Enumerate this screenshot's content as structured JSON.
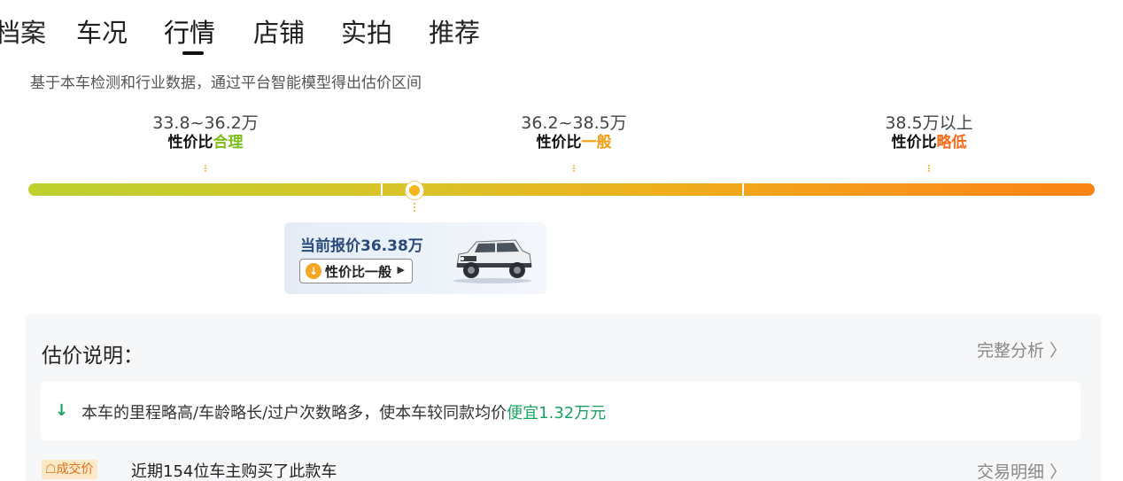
{
  "tabs": [
    {
      "label": "档案",
      "active": false
    },
    {
      "label": "车况",
      "active": false
    },
    {
      "label": "行情",
      "active": true
    },
    {
      "label": "店铺",
      "active": false
    },
    {
      "label": "实拍",
      "active": false
    },
    {
      "label": "推荐",
      "active": false
    }
  ],
  "subtitle": "基于本车检测和行业数据，通过平台智能模型得出估价区间",
  "ranges": [
    {
      "price": "33.8~36.2万",
      "verdict_prefix": "性价比",
      "verdict_tag": "合理",
      "color": "#7cbd17"
    },
    {
      "price": "36.2~38.5万",
      "verdict_prefix": "性价比",
      "verdict_tag": "一般",
      "color": "#f39c12"
    },
    {
      "price": "38.5万以上",
      "verdict_prefix": "性价比",
      "verdict_tag": "略低",
      "color": "#fa6b18"
    }
  ],
  "current": {
    "price_label": "当前报价36.38万",
    "verdict": "性价比一般",
    "price_wan": 36.38,
    "car_icon": "suv-car-image"
  },
  "explain": {
    "title": "估价说明：",
    "full_analysis": "完整分析",
    "reason_text": "本车的里程略高/车龄略长/过户次数略多，使本车较同款均价",
    "reason_highlight": "便宜1.32万元",
    "deal_badge": "成交价",
    "deal_text": "近期154位车主购买了此款车",
    "deal_detail": "交易明细"
  },
  "colors": {
    "accent_green": "#1aa260",
    "bar_start": "#bdd12f",
    "bar_end": "#fa8316"
  }
}
